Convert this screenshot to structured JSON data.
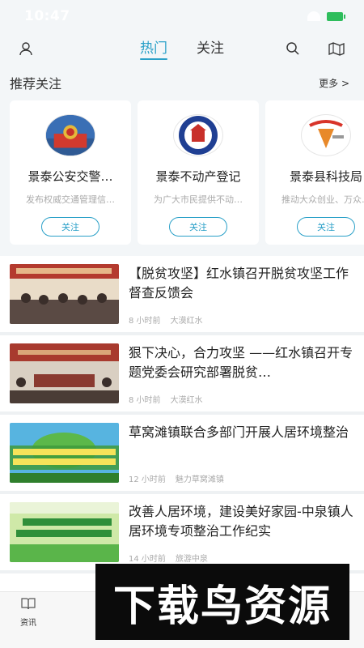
{
  "status": {
    "time": "10:47"
  },
  "nav": {
    "tabs": [
      {
        "label": "热门",
        "active": true
      },
      {
        "label": "关注",
        "active": false
      }
    ],
    "icons": [
      "user-icon",
      "search-icon",
      "map-icon"
    ]
  },
  "recommended": {
    "title": "推荐关注",
    "more": "更多 >",
    "cards": [
      {
        "name": "景泰公安交警…",
        "desc": "发布权威交通管理信…",
        "button": "关注",
        "logo": "police-emblem"
      },
      {
        "name": "景泰不动产登记",
        "desc": "为广大市民提供不动…",
        "button": "关注",
        "logo": "real-estate-seal"
      },
      {
        "name": "景泰县科技局",
        "desc": "推动大众创业、万众…",
        "button": "关注",
        "logo": "science-bureau-logo"
      }
    ]
  },
  "news": [
    {
      "title": "【脱贫攻坚】红水镇召开脱贫攻坚工作督查反馈会",
      "time": "8 小时前",
      "source": "大漠红水",
      "thumb_color": "#b43a2e"
    },
    {
      "title": "狠下决心，合力攻坚 ——红水镇召开专题党委会研究部署脱贫…",
      "time": "8 小时前",
      "source": "大漠红水",
      "thumb_color": "#a83a2e"
    },
    {
      "title": "草窝滩镇联合多部门开展人居环境整治",
      "time": "12 小时前",
      "source": "魅力草窝滩镇",
      "thumb_color": "#3fa04a"
    },
    {
      "title": "改善人居环境，建设美好家园-中泉镇人居环境专项整治工作纪实",
      "time": "14 小时前",
      "source": "旅游中泉",
      "thumb_color": "#4caf50"
    }
  ],
  "tabbar": {
    "items": [
      {
        "label": "资讯",
        "icon": "book-icon"
      }
    ]
  },
  "watermark": {
    "text": "下载鸟资源"
  }
}
